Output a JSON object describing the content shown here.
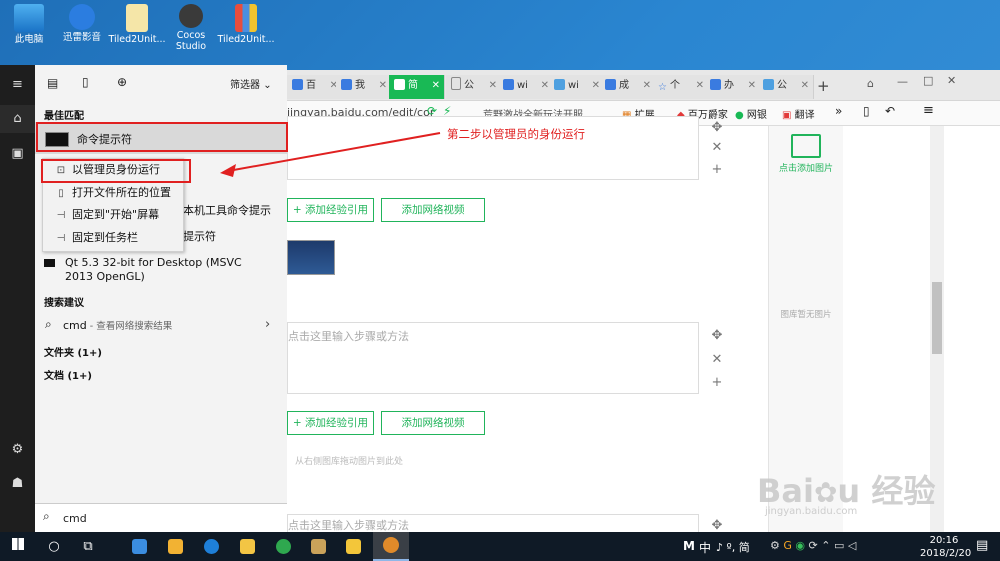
{
  "desktop": {
    "icons": [
      {
        "label": "此电脑"
      },
      {
        "label": "迅雷影音"
      },
      {
        "label": "Tiled2Unit..."
      },
      {
        "label": "Cocos\nStudio"
      },
      {
        "label": "Tiled2Unit..."
      }
    ]
  },
  "browser": {
    "tabs": [
      {
        "label": "百"
      },
      {
        "label": "我"
      },
      {
        "label": "简"
      },
      {
        "label": "公"
      },
      {
        "label": "wi"
      },
      {
        "label": "wi"
      },
      {
        "label": "成"
      },
      {
        "label": "个"
      },
      {
        "label": "办"
      },
      {
        "label": "公"
      }
    ],
    "new_tab": "+",
    "window_controls": {
      "min": "—",
      "max": "□",
      "close": "✕"
    },
    "address": "jingyan.baidu.com/edit/cor",
    "address_news": "荒野激战全新玩法开服",
    "toolbar": {
      "ext": "扩展",
      "bwfj": "百万爵家",
      "wy": "网银",
      "fy": "翻译",
      "more": "»"
    },
    "editor": {
      "annotation": "第二步以管理员的身份运行",
      "step_placeholder": "点击这里输入步骤或方法",
      "add_exp": "+ 添加经验引用",
      "add_video": "添加网络视频",
      "drag_hint": "从右侧图库拖动图片到此处",
      "add_image": "点击添加图片",
      "gallery_empty": "图库暂无图片"
    }
  },
  "start_menu": {
    "filter": "筛选器",
    "best_match": "最佳匹配",
    "cmd_title": "命令提示符",
    "cmd_sub1": "本机工具命令提示",
    "cmd_sub2": "提示符",
    "qt_label": "Qt 5.3 32-bit for Desktop (MSVC 2013 OpenGL)",
    "search_suggest": "搜索建议",
    "search_item": "cmd",
    "search_item_sub": " - 查看网络搜索结果",
    "folders": "文件夹 (1+)",
    "docs": "文档 (1+)",
    "search_query": "cmd",
    "context_menu": [
      {
        "label": "以管理员身份运行"
      },
      {
        "label": "打开文件所在的位置"
      },
      {
        "label": "固定到\"开始\"屏幕"
      },
      {
        "label": "固定到任务栏"
      }
    ]
  },
  "taskbar": {
    "ime_mode": "M",
    "ime_lang": "中",
    "ime_extra": "♪ º, 简",
    "time": "20:16",
    "date": "2018/2/20"
  },
  "colors": {
    "accent": "#19b955",
    "annotation": "#e02020",
    "taskbar": "#0f1a26"
  }
}
